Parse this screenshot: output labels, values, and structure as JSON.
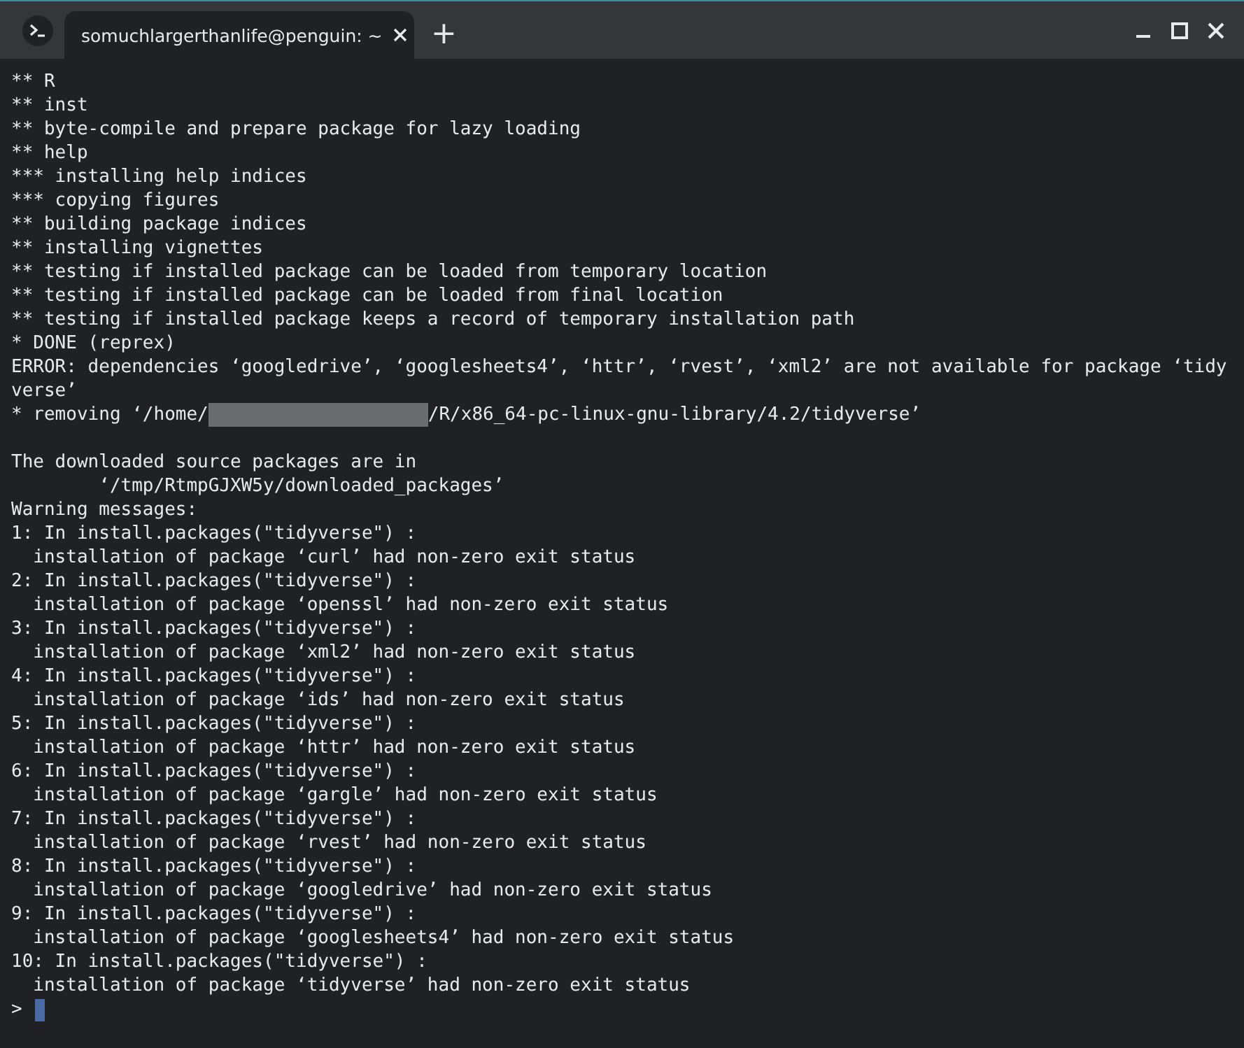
{
  "window": {
    "tab_title": "somuchlargerthanlife@penguin: ~",
    "new_tab": "+"
  },
  "terminal": {
    "lines": [
      {
        "kind": "text",
        "text": "** R"
      },
      {
        "kind": "text",
        "text": "** inst"
      },
      {
        "kind": "text",
        "text": "** byte-compile and prepare package for lazy loading"
      },
      {
        "kind": "text",
        "text": "** help"
      },
      {
        "kind": "text",
        "text": "*** installing help indices"
      },
      {
        "kind": "text",
        "text": "*** copying figures"
      },
      {
        "kind": "text",
        "text": "** building package indices"
      },
      {
        "kind": "text",
        "text": "** installing vignettes"
      },
      {
        "kind": "text",
        "text": "** testing if installed package can be loaded from temporary location"
      },
      {
        "kind": "text",
        "text": "** testing if installed package can be loaded from final location"
      },
      {
        "kind": "text",
        "text": "** testing if installed package keeps a record of temporary installation path"
      },
      {
        "kind": "text",
        "text": "* DONE (reprex)"
      },
      {
        "kind": "text",
        "text": "ERROR: dependencies ‘googledrive’, ‘googlesheets4’, ‘httr’, ‘rvest’, ‘xml2’ are not available for package ‘tidy"
      },
      {
        "kind": "text",
        "text": "verse’"
      },
      {
        "kind": "redacted",
        "text": "* removing ‘/home/",
        "text_after": "/R/x86_64-pc-linux-gnu-library/4.2/tidyverse’"
      },
      {
        "kind": "blank"
      },
      {
        "kind": "text",
        "text": "The downloaded source packages are in"
      },
      {
        "kind": "text",
        "text": "        ‘/tmp/RtmpGJXW5y/downloaded_packages’"
      },
      {
        "kind": "text",
        "text": "Warning messages:"
      },
      {
        "kind": "text",
        "text": "1: In install.packages(\"tidyverse\") :"
      },
      {
        "kind": "text",
        "text": "  installation of package ‘curl’ had non-zero exit status"
      },
      {
        "kind": "text",
        "text": "2: In install.packages(\"tidyverse\") :"
      },
      {
        "kind": "text",
        "text": "  installation of package ‘openssl’ had non-zero exit status"
      },
      {
        "kind": "text",
        "text": "3: In install.packages(\"tidyverse\") :"
      },
      {
        "kind": "text",
        "text": "  installation of package ‘xml2’ had non-zero exit status"
      },
      {
        "kind": "text",
        "text": "4: In install.packages(\"tidyverse\") :"
      },
      {
        "kind": "text",
        "text": "  installation of package ‘ids’ had non-zero exit status"
      },
      {
        "kind": "text",
        "text": "5: In install.packages(\"tidyverse\") :"
      },
      {
        "kind": "text",
        "text": "  installation of package ‘httr’ had non-zero exit status"
      },
      {
        "kind": "text",
        "text": "6: In install.packages(\"tidyverse\") :"
      },
      {
        "kind": "text",
        "text": "  installation of package ‘gargle’ had non-zero exit status"
      },
      {
        "kind": "text",
        "text": "7: In install.packages(\"tidyverse\") :"
      },
      {
        "kind": "text",
        "text": "  installation of package ‘rvest’ had non-zero exit status"
      },
      {
        "kind": "text",
        "text": "8: In install.packages(\"tidyverse\") :"
      },
      {
        "kind": "text",
        "text": "  installation of package ‘googledrive’ had non-zero exit status"
      },
      {
        "kind": "text",
        "text": "9: In install.packages(\"tidyverse\") :"
      },
      {
        "kind": "text",
        "text": "  installation of package ‘googlesheets4’ had non-zero exit status"
      },
      {
        "kind": "text",
        "text": "10: In install.packages(\"tidyverse\") :"
      },
      {
        "kind": "text",
        "text": "  installation of package ‘tidyverse’ had non-zero exit status"
      },
      {
        "kind": "prompt",
        "text": ">"
      }
    ]
  }
}
